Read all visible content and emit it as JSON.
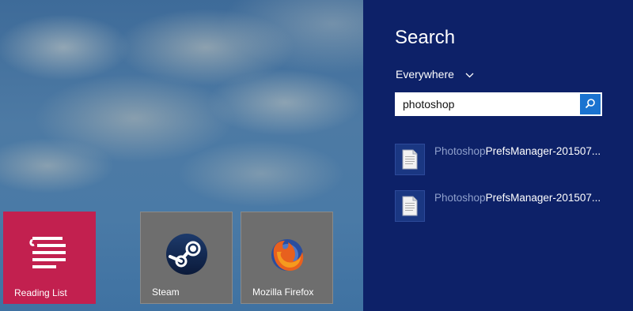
{
  "tiles": [
    {
      "label": "Reading List",
      "icon": "reading-list-icon",
      "color": "#c2204f"
    },
    {
      "label": "Steam",
      "icon": "steam-icon",
      "color": "#6e6e6e"
    },
    {
      "label": "Mozilla Firefox",
      "icon": "firefox-icon",
      "color": "#6e6e6e"
    }
  ],
  "search": {
    "title": "Search",
    "scope": "Everywhere",
    "query": "photoshop",
    "button_icon": "search-icon",
    "pane_color": "#0d2168",
    "results": [
      {
        "match": "Photoshop",
        "rest": "PrefsManager-201507...",
        "icon": "document-icon"
      },
      {
        "match": "Photoshop",
        "rest": "PrefsManager-201507...",
        "icon": "document-icon"
      }
    ]
  }
}
